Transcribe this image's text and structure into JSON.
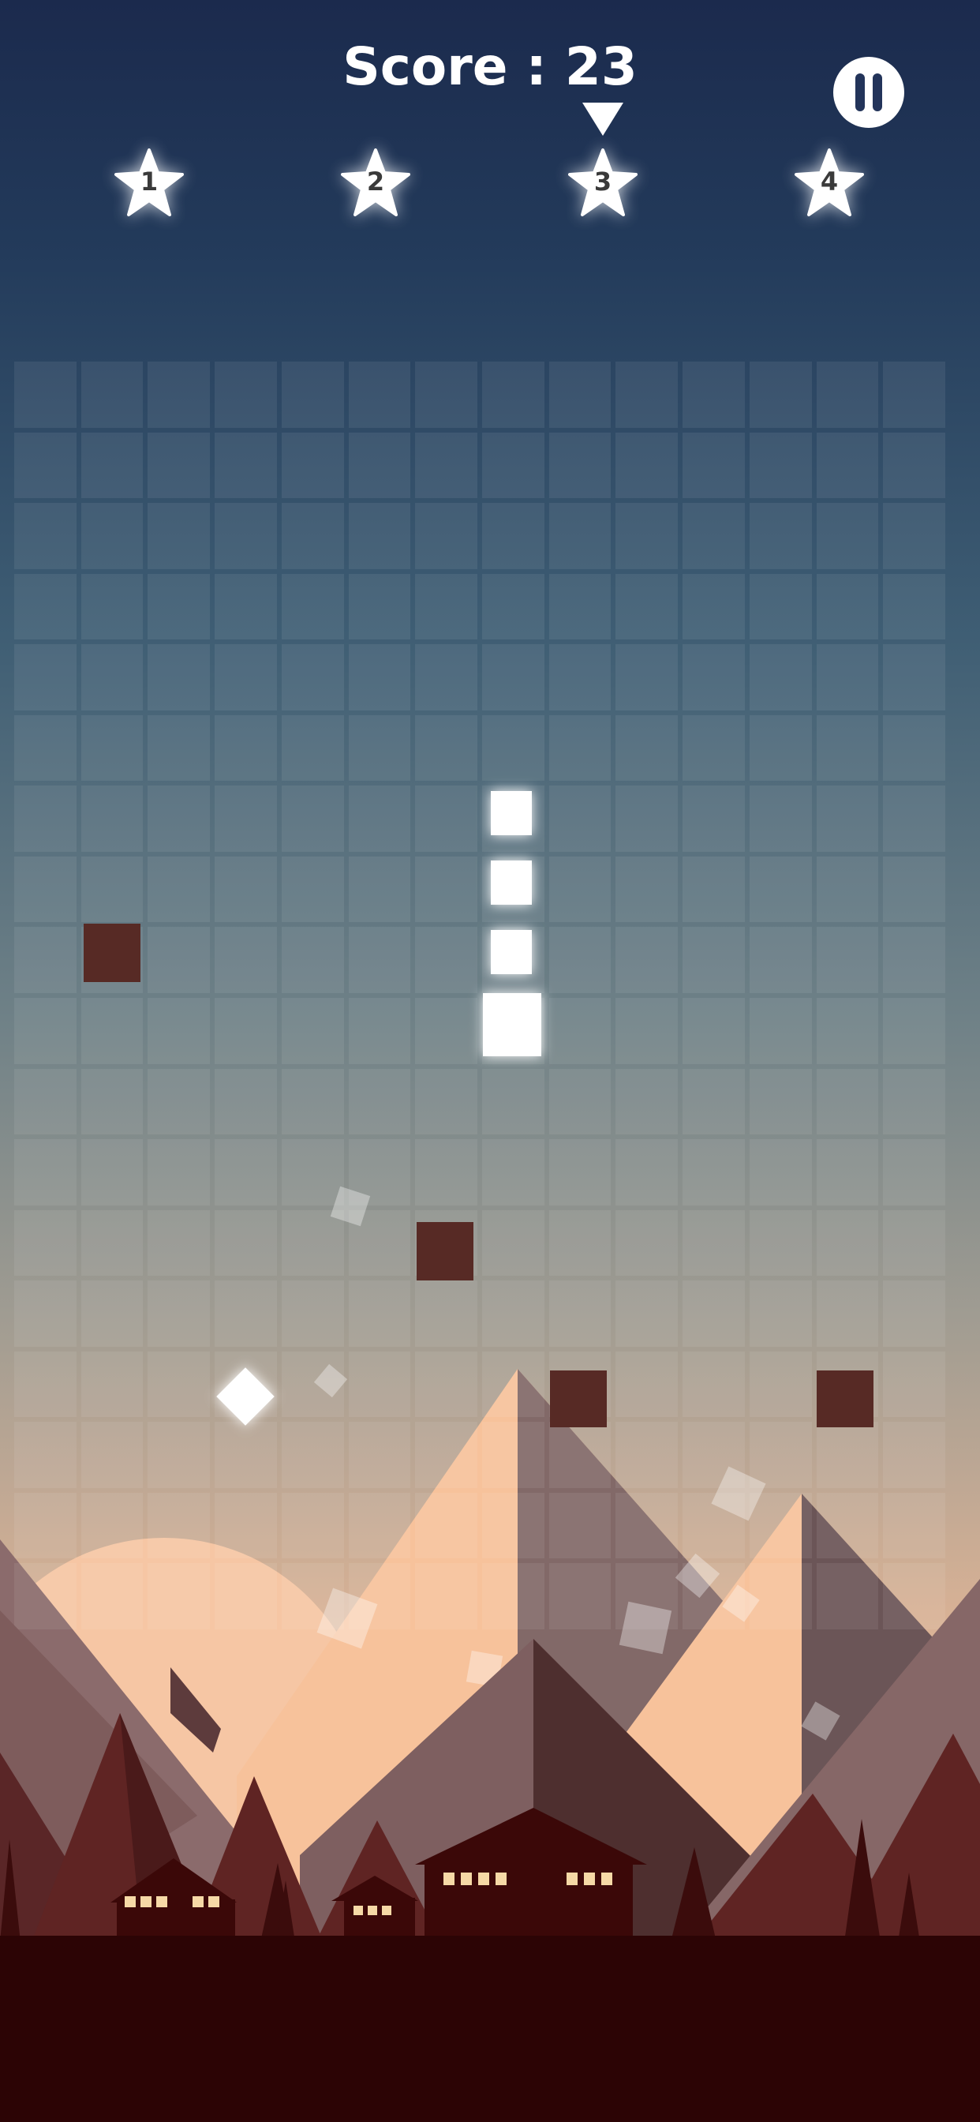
{
  "hud": {
    "score_label": "Score : 23",
    "stars": [
      {
        "label": "1"
      },
      {
        "label": "2"
      },
      {
        "label": "3",
        "selected": true
      },
      {
        "label": "4"
      }
    ]
  },
  "colors": {
    "block_light": "#ffffff",
    "block_dark": "#572a25",
    "window_light": "#f6d9a6",
    "ground": "#2c0405"
  },
  "icons": [
    "pause-icon",
    "star-icon",
    "down-arrow-icon"
  ],
  "board": {
    "columns": 14,
    "rows": 18
  }
}
